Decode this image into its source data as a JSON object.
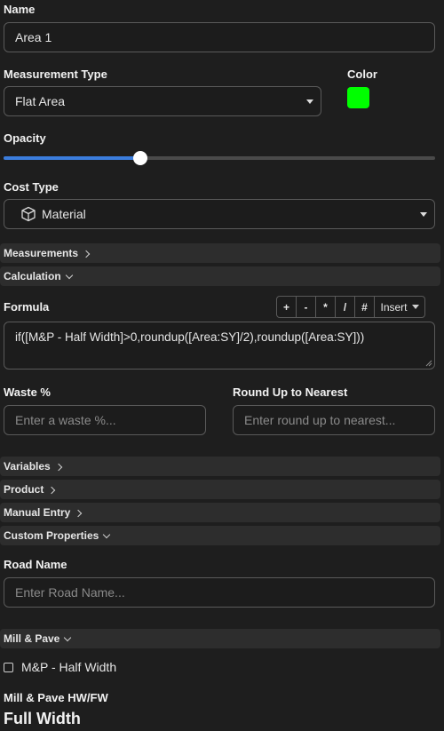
{
  "name": {
    "label": "Name",
    "value": "Area 1"
  },
  "measurement_type": {
    "label": "Measurement Type",
    "value": "Flat Area"
  },
  "color": {
    "label": "Color",
    "swatch": "#00ff00"
  },
  "opacity": {
    "label": "Opacity",
    "value_fraction": 0.31
  },
  "cost_type": {
    "label": "Cost Type",
    "value": "Material",
    "icon": "cube-icon"
  },
  "sections": {
    "measurements": "Measurements",
    "calculation": "Calculation",
    "variables": "Variables",
    "product": "Product",
    "manual_entry": "Manual Entry",
    "custom_properties": "Custom Properties",
    "mill_pave": "Mill & Pave"
  },
  "formula": {
    "label": "Formula",
    "operators": [
      "+",
      "-",
      "*",
      "/",
      "#"
    ],
    "insert_label": "Insert",
    "value": "if([M&P - Half Width]>0,roundup([Area:SY]/2),roundup([Area:SY]))"
  },
  "waste": {
    "label": "Waste %",
    "placeholder": "Enter a waste %..."
  },
  "round_up": {
    "label": "Round Up to Nearest",
    "placeholder": "Enter round up to nearest..."
  },
  "road_name": {
    "label": "Road Name",
    "placeholder": "Enter Road Name..."
  },
  "mp_half_width": {
    "label": "M&P - Half Width",
    "checked": false
  },
  "mill_pave_hwfw": {
    "label": "Mill & Pave HW/FW",
    "value": "Full Width"
  },
  "colors": {
    "accent": "#3b7ddd",
    "background": "#1e1e1e",
    "section": "#2d2d2d"
  }
}
